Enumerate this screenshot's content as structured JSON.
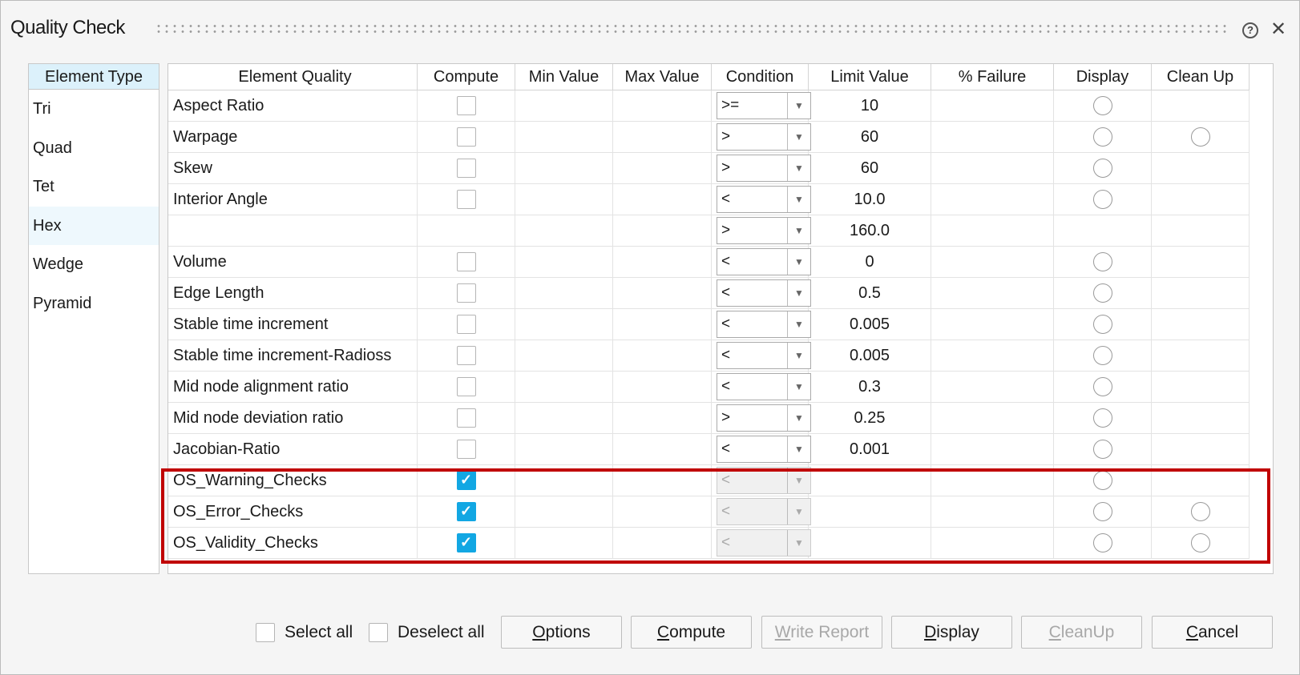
{
  "window": {
    "title": "Quality Check",
    "help_icon": "?",
    "close_icon": "✕"
  },
  "element_types": {
    "header": "Element Type",
    "items": [
      "Tri",
      "Quad",
      "Tet",
      "Hex",
      "Wedge",
      "Pyramid"
    ],
    "selected": "Hex"
  },
  "table": {
    "columns": [
      "Element Quality",
      "Compute",
      "Min Value",
      "Max Value",
      "Condition",
      "Limit Value",
      "% Failure",
      "Display",
      "Clean Up"
    ],
    "rows": [
      {
        "name": "Aspect Ratio",
        "compute": false,
        "condition": ">=",
        "limit": "10",
        "display": true,
        "cleanup": false,
        "disabled": false
      },
      {
        "name": "Warpage",
        "compute": false,
        "condition": ">",
        "limit": "60",
        "display": true,
        "cleanup": true,
        "disabled": false
      },
      {
        "name": "Skew",
        "compute": false,
        "condition": ">",
        "limit": "60",
        "display": true,
        "cleanup": false,
        "disabled": false
      },
      {
        "name": "Interior Angle",
        "compute": false,
        "condition": "<",
        "limit": "10.0",
        "display": true,
        "cleanup": false,
        "disabled": false
      },
      {
        "name": "",
        "compute": null,
        "condition": ">",
        "limit": "160.0",
        "display": false,
        "cleanup": false,
        "disabled": false
      },
      {
        "name": "Volume",
        "compute": false,
        "condition": "<",
        "limit": "0",
        "display": true,
        "cleanup": false,
        "disabled": false
      },
      {
        "name": "Edge Length",
        "compute": false,
        "condition": "<",
        "limit": "0.5",
        "display": true,
        "cleanup": false,
        "disabled": false
      },
      {
        "name": "Stable time increment",
        "compute": false,
        "condition": "<",
        "limit": "0.005",
        "display": true,
        "cleanup": false,
        "disabled": false
      },
      {
        "name": "Stable time increment-Radioss",
        "compute": false,
        "condition": "<",
        "limit": "0.005",
        "display": true,
        "cleanup": false,
        "disabled": false
      },
      {
        "name": "Mid node alignment ratio",
        "compute": false,
        "condition": "<",
        "limit": "0.3",
        "display": true,
        "cleanup": false,
        "disabled": false
      },
      {
        "name": "Mid node deviation ratio",
        "compute": false,
        "condition": ">",
        "limit": "0.25",
        "display": true,
        "cleanup": false,
        "disabled": false
      },
      {
        "name": "Jacobian-Ratio",
        "compute": false,
        "condition": "<",
        "limit": "0.001",
        "display": true,
        "cleanup": false,
        "disabled": false
      },
      {
        "name": "OS_Warning_Checks",
        "compute": true,
        "condition": "<",
        "limit": "",
        "display": true,
        "cleanup": false,
        "disabled": true
      },
      {
        "name": "OS_Error_Checks",
        "compute": true,
        "condition": "<",
        "limit": "",
        "display": true,
        "cleanup": true,
        "disabled": true
      },
      {
        "name": "OS_Validity_Checks",
        "compute": true,
        "condition": "<",
        "limit": "",
        "display": true,
        "cleanup": true,
        "disabled": true
      }
    ]
  },
  "footer": {
    "select_all": "Select all",
    "deselect_all": "Deselect all",
    "buttons": [
      {
        "label": "Options",
        "key": "O",
        "enabled": true
      },
      {
        "label": "Compute",
        "key": "C",
        "enabled": true
      },
      {
        "label": "Write Report",
        "key": "W",
        "enabled": false
      },
      {
        "label": "Display",
        "key": "D",
        "enabled": true
      },
      {
        "label": "CleanUp",
        "key": "C",
        "enabled": false
      },
      {
        "label": "Cancel",
        "key": "C",
        "enabled": true
      }
    ]
  },
  "colors": {
    "highlight": "#c00000",
    "check": "#12a7e3",
    "header_bg": "#dcf1fb"
  }
}
